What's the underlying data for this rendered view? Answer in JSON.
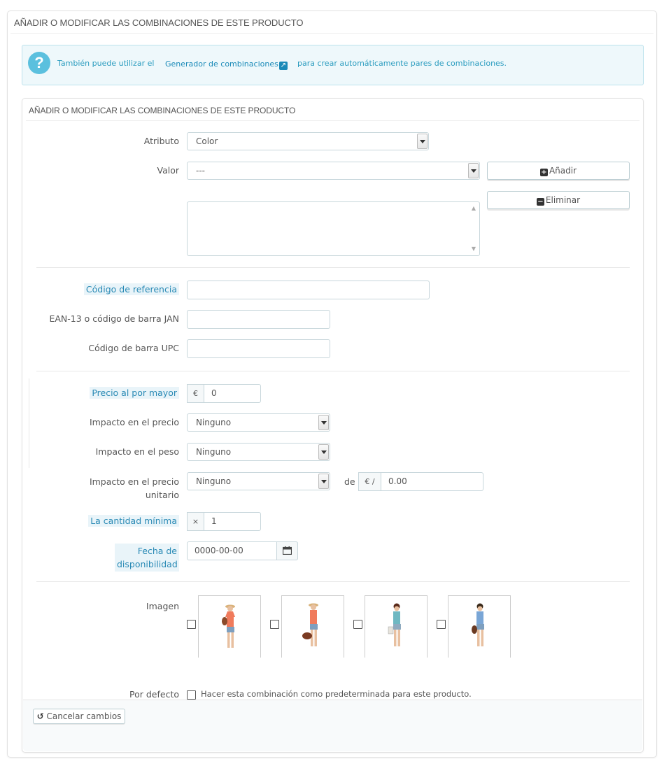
{
  "outer_panel": {
    "heading": "AÑADIR O MODIFICAR LAS COMBINACIONES DE ESTE PRODUCTO"
  },
  "alert": {
    "icon": "question-circle-icon",
    "text_before": "También puede utilizar el",
    "link_text": "Generador de combinaciones",
    "link_icon": "external-link-icon",
    "text_after": "para crear automáticamente pares de combinaciones."
  },
  "inner_panel": {
    "heading": "AÑADIR O MODIFICAR LAS COMBINACIONES DE ESTE PRODUCTO"
  },
  "form": {
    "attribute": {
      "label": "Atributo",
      "value": "Color"
    },
    "value": {
      "label": "Valor",
      "value": "---"
    },
    "add_button": "Añadir",
    "remove_button": "Eliminar",
    "reference": {
      "label": "Código de referencia",
      "value": ""
    },
    "ean13": {
      "label": "EAN-13 o código de barra JAN",
      "value": ""
    },
    "upc": {
      "label": "Código de barra UPC",
      "value": ""
    },
    "wholesale_price": {
      "label": "Precio al por mayor",
      "currency": "€",
      "value": "0"
    },
    "price_impact": {
      "label": "Impacto en el precio",
      "value": "Ninguno"
    },
    "weight_impact": {
      "label": "Impacto en el peso",
      "value": "Ninguno"
    },
    "unit_price_impact": {
      "label": "Impacto en el precio unitario",
      "value": "Ninguno",
      "de_label": "de",
      "currency": "€ /",
      "amount": "0.00"
    },
    "min_quantity": {
      "label": "La cantidad mínima",
      "prefix": "×",
      "value": "1"
    },
    "availability_date": {
      "label": "Fecha de disponibilidad",
      "value": "0000-00-00",
      "icon": "calendar-icon"
    },
    "image": {
      "label": "Imagen"
    },
    "default": {
      "label": "Por defecto",
      "text": "Hacer esta combinación como predeterminada para este producto."
    }
  },
  "footer": {
    "cancel_button": "Cancelar cambios",
    "cancel_icon": "undo-icon"
  },
  "colors": {
    "accent": "#2a8ab5",
    "alert_bg": "#eef8fb",
    "info": "#5bc0de"
  }
}
